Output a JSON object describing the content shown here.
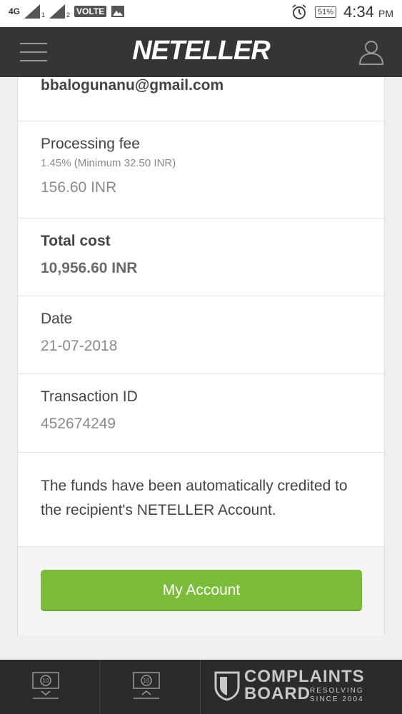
{
  "status_bar": {
    "network": "4G",
    "sim1": "1",
    "sim2": "2",
    "volte": "VOLTE",
    "battery": "51%",
    "time": "4:34",
    "ampm": "PM"
  },
  "header": {
    "logo": "NETELLER"
  },
  "details": {
    "email": "bbalogunanu@gmail.com",
    "fee_label": "Processing fee",
    "fee_rate": "1.45% (Minimum 32.50 INR)",
    "fee_value": "156.60 INR",
    "total_label": "Total cost",
    "total_value": "10,956.60 INR",
    "date_label": "Date",
    "date_value": "21-07-2018",
    "txn_label": "Transaction ID",
    "txn_value": "452674249",
    "note": "The funds have been automatically credited to the recipient's NETELLER Account."
  },
  "actions": {
    "my_account": "My Account"
  },
  "bottom_bar": {
    "item1": "10",
    "item2": "10"
  },
  "watermark": {
    "line1": "COMPLAINTS",
    "line2": "BOARD",
    "tag1": "RESOLVING",
    "tag2": "SINCE 2004"
  },
  "colors": {
    "accent": "#7bbd3b",
    "navbar": "#353535"
  }
}
